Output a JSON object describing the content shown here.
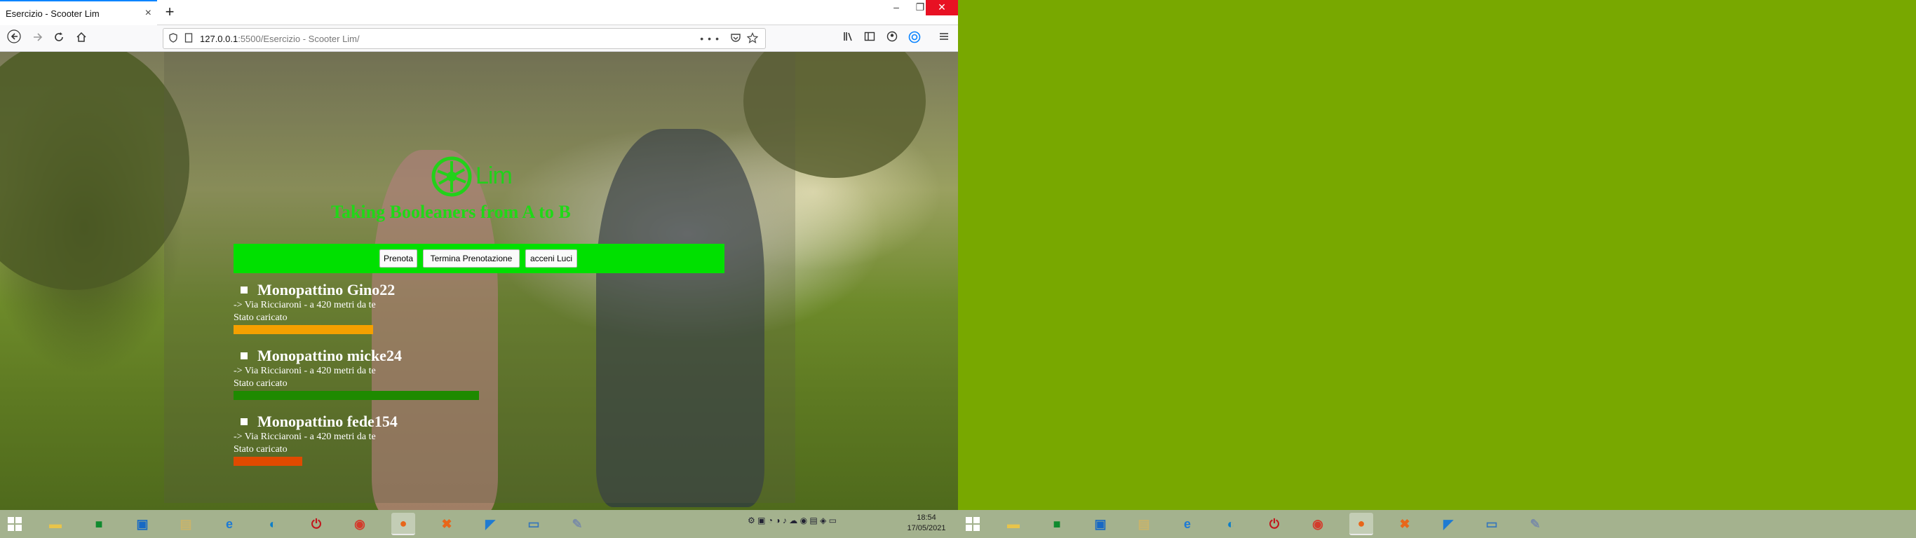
{
  "browser": {
    "tab_title": "Esercizio - Scooter Lim",
    "tab_close": "×",
    "new_tab": "+",
    "url_host": "127.0.0.1",
    "url_path": ":5500/Esercizio - Scooter Lim/",
    "url_actions": "•••",
    "win_min": "–",
    "win_max": "❐",
    "win_close": "✕"
  },
  "page": {
    "brand": "Lim",
    "tagline": "Taking Booleaners from A to B",
    "menu": {
      "prenota": "Prenota",
      "termina": "Termina Prenotazione",
      "luci": "acceni Luci"
    },
    "scooters": [
      {
        "name": "Monopattino Gino22",
        "location": "-> Via Ricciaroni - a 420 metri da te",
        "status_label": "Stato caricato",
        "charge": 0.57,
        "bar_color": "#f5a000"
      },
      {
        "name": "Monopattino micke24",
        "location": "-> Via Ricciaroni - a 420 metri da te",
        "status_label": "Stato caricato",
        "charge": 1.0,
        "bar_color": "#1e8a00"
      },
      {
        "name": "Monopattino fede154",
        "location": "-> Via Ricciaroni - a 420 metri da te",
        "status_label": "Stato caricato",
        "charge": 0.28,
        "bar_color": "#e04a00"
      }
    ]
  },
  "taskbar": {
    "clock_time": "18:54",
    "clock_date": "17/05/2021",
    "icons": [
      "start-icon",
      "file-explorer-icon",
      "store-icon",
      "photos-icon",
      "folder-icon",
      "internet-explorer-icon",
      "edge-icon",
      "power-app-icon",
      "chrome-icon",
      "firefox-icon",
      "xampp-icon",
      "vscode-icon",
      "image-viewer-icon",
      "paint-icon"
    ]
  },
  "colors": {
    "accent_green": "#00e000",
    "brand_green": "#22d11a",
    "desktop": "#78a800",
    "taskbar": "#a4b28e"
  }
}
